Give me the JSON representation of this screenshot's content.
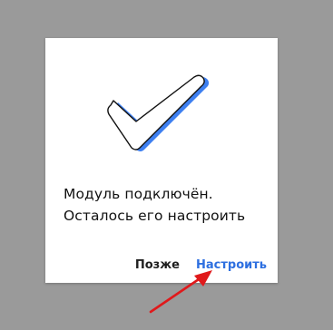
{
  "dialog": {
    "message_line1": "Модуль подключён.",
    "message_line2": "Осталось его настроить",
    "later_label": "Позже",
    "setup_label": "Настроить"
  },
  "icons": {
    "illustration": "checkmark-icon",
    "annotation": "red-arrow-icon"
  },
  "colors": {
    "backdrop": "#9a9a9a",
    "dialog": "#ffffff",
    "accent": "#2d6fe0",
    "check_shadow": "#3d7ff0",
    "arrow": "#e0191b"
  }
}
